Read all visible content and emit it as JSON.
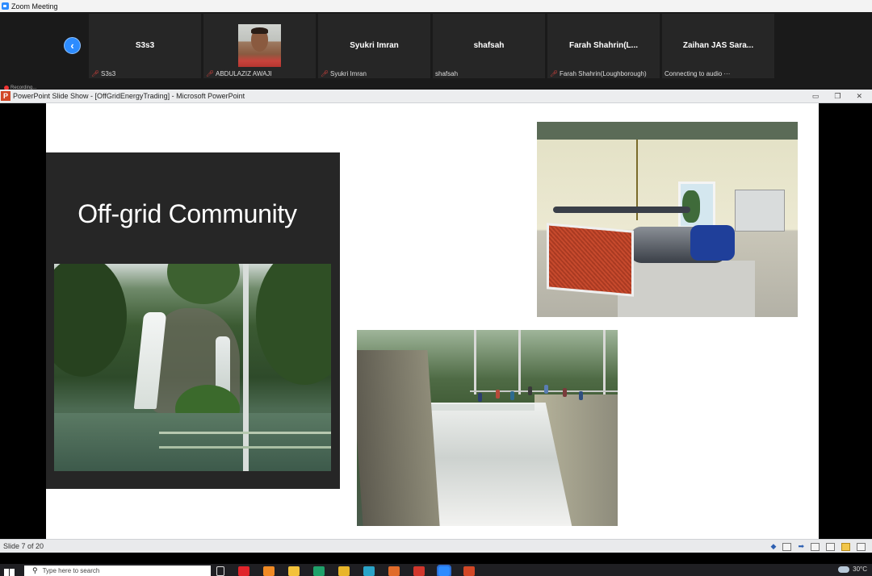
{
  "zoom": {
    "window_title": "Zoom Meeting",
    "prev_button_glyph": "‹",
    "participants": [
      {
        "name": "S3s3",
        "label": "S3s3",
        "muted": true,
        "video": false
      },
      {
        "name": "",
        "label": "ABDULAZIZ AWAJI",
        "muted": true,
        "video": true
      },
      {
        "name": "Syukri Imran",
        "label": "Syukri Imran",
        "muted": true,
        "video": false
      },
      {
        "name": "shafsah",
        "label": "shafsah",
        "muted": false,
        "video": false
      },
      {
        "name": "Farah  Shahrin(L...",
        "label": "Farah Shahrin(Loughborough)",
        "muted": true,
        "video": false
      },
      {
        "name": "Zaihan JAS Sara...",
        "label": "Connecting to audio ···",
        "muted": false,
        "video": false
      }
    ],
    "recording_label": "Recording..."
  },
  "powerpoint": {
    "window_title": "PowerPoint Slide Show - [OffGridEnergyTrading] - Microsoft PowerPoint",
    "icon_letter": "P",
    "window_buttons": [
      "▭",
      "❐",
      "✕"
    ],
    "slide": {
      "title": "Off-grid Community"
    },
    "status": {
      "slide_counter": "Slide 7 of 20",
      "prev_glyph": "◆",
      "next_glyph": "➡"
    }
  },
  "taskbar": {
    "search_placeholder": "Type here to search",
    "search_glyph": "⚲",
    "tray_temp": "30°C",
    "app_icons": [
      {
        "name": "task-view-icon",
        "color": "#1f1f23",
        "active": false
      },
      {
        "name": "opera-icon",
        "color": "#e0242b",
        "active": false
      },
      {
        "name": "firefox-icon",
        "color": "#f08a24",
        "active": false
      },
      {
        "name": "file-explorer-icon",
        "color": "#f3c23b",
        "active": false
      },
      {
        "name": "edge-icon",
        "color": "#1fa16a",
        "active": false
      },
      {
        "name": "chrome-icon",
        "color": "#e8b52a",
        "active": false
      },
      {
        "name": "cortana-icon",
        "color": "#2aa4c8",
        "active": false
      },
      {
        "name": "app-orange-icon",
        "color": "#e06b2a",
        "active": false
      },
      {
        "name": "app-red-icon",
        "color": "#d2362c",
        "active": false
      },
      {
        "name": "zoom-icon",
        "color": "#2d8cff",
        "active": true
      },
      {
        "name": "powerpoint-icon",
        "color": "#d24726",
        "active": false
      }
    ]
  }
}
